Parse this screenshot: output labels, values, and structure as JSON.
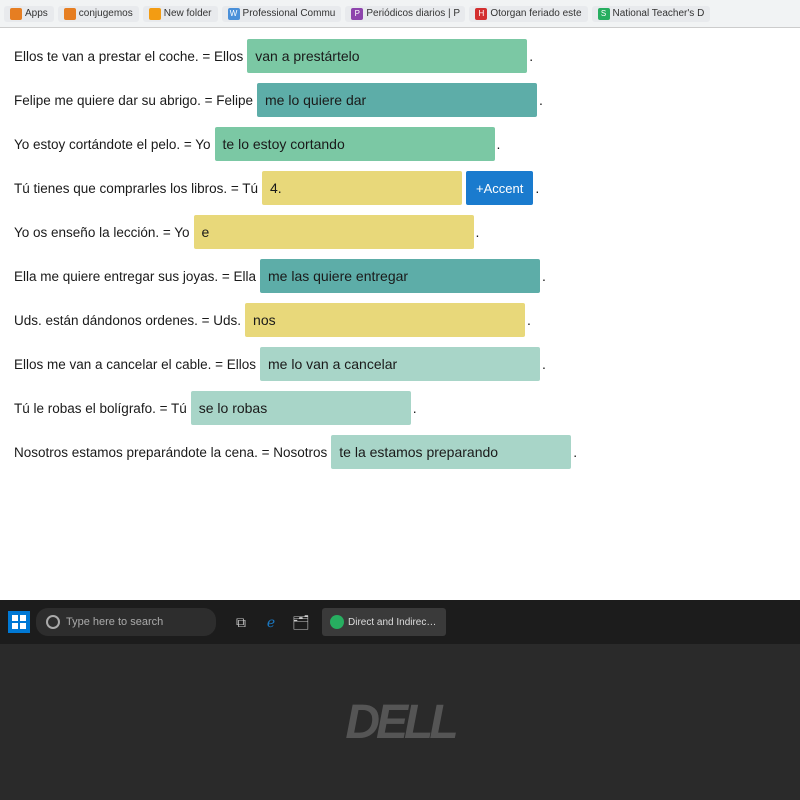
{
  "browser": {
    "tabs": [
      {
        "id": "apps",
        "label": "Apps",
        "color": "#e67e22",
        "icon": "■"
      },
      {
        "id": "conjugemos",
        "label": "conjugemos",
        "color": "#e67e22",
        "icon": "■"
      },
      {
        "id": "new-folder",
        "label": "New folder",
        "color": "#f39c12",
        "icon": "■"
      },
      {
        "id": "professional",
        "label": "Professional Commu",
        "color": "#4a90d9",
        "icon": "■"
      },
      {
        "id": "periodicos",
        "label": "Periódicos diarios | P",
        "color": "#8e44ad",
        "icon": "■"
      },
      {
        "id": "otorgan",
        "label": "Otorgan feriado este",
        "color": "#d32f2f",
        "icon": "H"
      },
      {
        "id": "national",
        "label": "National Teacher's D",
        "color": "#27ae60",
        "icon": "S"
      }
    ]
  },
  "exercises": [
    {
      "id": 1,
      "prefix": "Ellos te van a prestar el coche. = Ellos",
      "answer": "van a prestártelo",
      "color": "green",
      "showPeriod": true
    },
    {
      "id": 2,
      "prefix": "Felipe me quiere dar su abrigo. = Felipe",
      "answer": "me lo quiere dar",
      "color": "teal",
      "showPeriod": true
    },
    {
      "id": 3,
      "prefix": "Yo estoy cortándote el pelo. = Yo",
      "answer": "te lo estoy cortando",
      "color": "green",
      "showPeriod": true
    },
    {
      "id": 4,
      "prefix": "Tú tienes que comprarles los libros. = Tú",
      "answer": "4.",
      "color": "yellow",
      "showAccent": true,
      "showPeriod": true
    },
    {
      "id": 5,
      "prefix": "Yo os enseño la lección. = Yo",
      "answer": "e",
      "color": "yellow",
      "showPeriod": true
    },
    {
      "id": 6,
      "prefix": "Ella me quiere entregar sus joyas. = Ella",
      "answer": "me las quiere entregar",
      "color": "teal",
      "showPeriod": true
    },
    {
      "id": 7,
      "prefix": "Uds. están dándonos ordenes. = Uds.",
      "answer": "nos",
      "color": "yellow",
      "showPeriod": true
    },
    {
      "id": 8,
      "prefix": "Ellos me van a cancelar el cable. = Ellos",
      "answer": "me lo van a cancelar",
      "color": "light-teal",
      "showPeriod": true
    },
    {
      "id": 9,
      "prefix": "Tú le robas el bolígrafo. = Tú",
      "answer": "se lo robas",
      "color": "light-teal",
      "showPeriod": true
    },
    {
      "id": 10,
      "prefix": "Nosotros estamos preparándote la cena. = Nosotros",
      "answer": "te la estamos preparando",
      "color": "light-teal",
      "showPeriod": true
    }
  ],
  "accent_button": "+Accent",
  "taskbar": {
    "search_placeholder": "Type here to search",
    "app_label": "Direct and Indirect ..."
  }
}
